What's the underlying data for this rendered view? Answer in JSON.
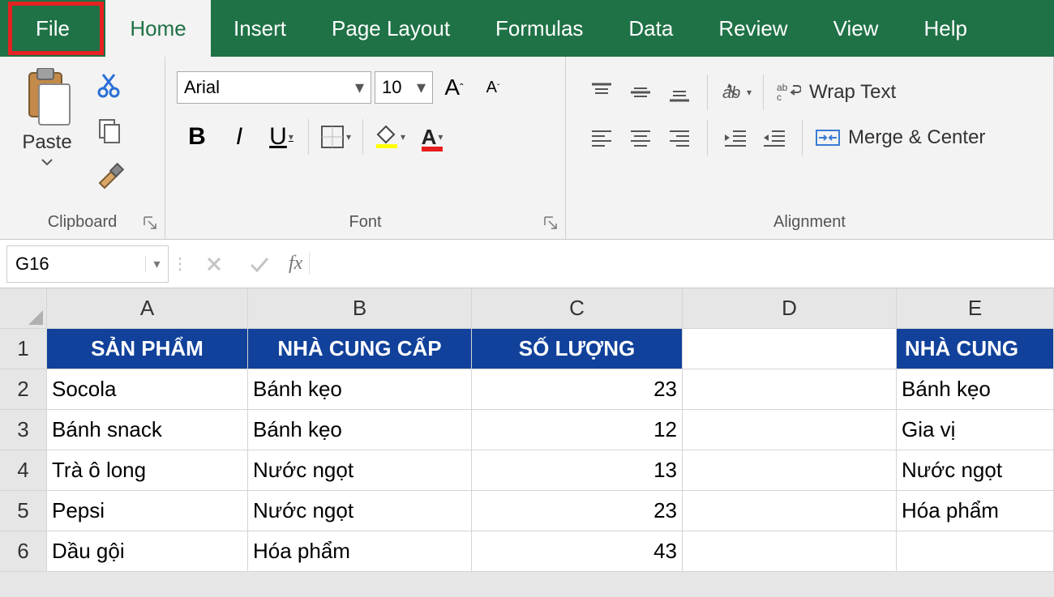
{
  "tabs": {
    "file": "File",
    "home": "Home",
    "rest": [
      "Insert",
      "Page Layout",
      "Formulas",
      "Data",
      "Review",
      "View",
      "Help"
    ]
  },
  "ribbon": {
    "clipboard": {
      "label": "Clipboard",
      "paste": "Paste"
    },
    "font": {
      "label": "Font",
      "name": "Arial",
      "size": "10",
      "bold": "B",
      "italic": "I",
      "underline": "U"
    },
    "alignment": {
      "label": "Alignment",
      "wrap": "Wrap Text",
      "merge": "Merge & Center"
    }
  },
  "fbar": {
    "namebox": "G16",
    "formula": ""
  },
  "columns": [
    "A",
    "B",
    "C",
    "D",
    "E"
  ],
  "rows": [
    "1",
    "2",
    "3",
    "4",
    "5",
    "6"
  ],
  "sheet": {
    "header": [
      "SẢN PHẨM",
      "NHÀ CUNG CẤP",
      "SỐ LƯỢNG",
      "",
      "NHÀ CUNG"
    ],
    "data": [
      [
        "Socola",
        "Bánh kẹo",
        "23",
        "",
        "Bánh kẹo"
      ],
      [
        "Bánh snack",
        "Bánh kẹo",
        "12",
        "",
        "Gia vị"
      ],
      [
        "Trà ô long",
        "Nước ngọt",
        "13",
        "",
        "Nước ngọt"
      ],
      [
        "Pepsi",
        "Nước ngọt",
        "23",
        "",
        "Hóa phẩm"
      ],
      [
        "Dầu gội",
        "Hóa phẩm",
        "43",
        "",
        ""
      ]
    ]
  }
}
